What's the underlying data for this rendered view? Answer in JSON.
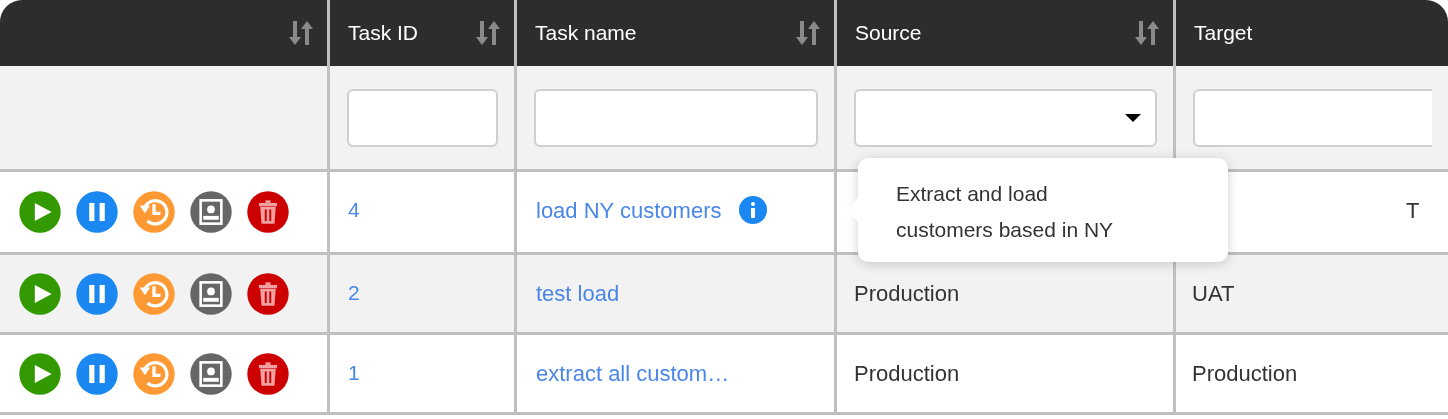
{
  "columns": [
    {
      "sortable": true
    },
    {
      "label": "Task ID",
      "sortable": true,
      "filter": {
        "kind": "text"
      }
    },
    {
      "label": "Task name",
      "sortable": true,
      "filter": {
        "kind": "text"
      }
    },
    {
      "label": "Source",
      "sortable": true,
      "filter": {
        "kind": "select"
      }
    },
    {
      "label": "Target",
      "sortable": false,
      "filter": {
        "kind": "text"
      }
    }
  ],
  "rows": [
    {
      "task_id": "4",
      "task_name": "load NY customers",
      "has_info": true,
      "target": "T",
      "target_partly_covered": true
    },
    {
      "task_id": "2",
      "task_name": "test load",
      "has_info": false,
      "source": "Production",
      "target": "UAT",
      "target_partly_covered": false
    },
    {
      "task_id": "1",
      "task_name": "extract all custom…",
      "has_info": false,
      "source": "Production",
      "target": "Production",
      "target_partly_covered": false
    }
  ],
  "tooltip": {
    "text": "Extract and load customers based in NY"
  }
}
